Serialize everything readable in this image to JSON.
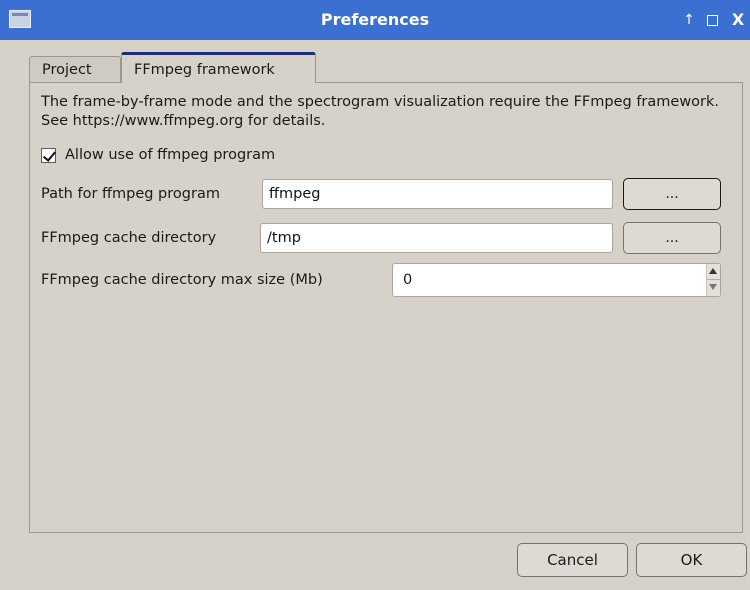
{
  "window": {
    "title": "Preferences",
    "controls": {
      "up_glyph": "↑",
      "close_glyph": "X"
    }
  },
  "tabs": [
    {
      "label": "Project",
      "selected": false
    },
    {
      "label": "FFmpeg framework",
      "selected": true
    }
  ],
  "ffmpeg": {
    "description": "The frame-by-frame mode and the spectrogram visualization require the FFmpeg framework. See https://www.ffmpeg.org for details.",
    "allow_checkbox": {
      "label": "Allow use of ffmpeg program",
      "checked": true
    },
    "path": {
      "label": "Path for ffmpeg program",
      "value": "ffmpeg",
      "browse_label": "..."
    },
    "cache_dir": {
      "label": "FFmpeg cache directory",
      "value": "/tmp",
      "browse_label": "..."
    },
    "cache_max": {
      "label": "FFmpeg cache directory max size (Mb)",
      "value": "0"
    }
  },
  "buttons": {
    "cancel": "Cancel",
    "ok": "OK"
  },
  "colors": {
    "titlebar": "#3b6fd1",
    "window_bg": "#d6d2ca",
    "tab_accent": "#1c2e7a"
  }
}
